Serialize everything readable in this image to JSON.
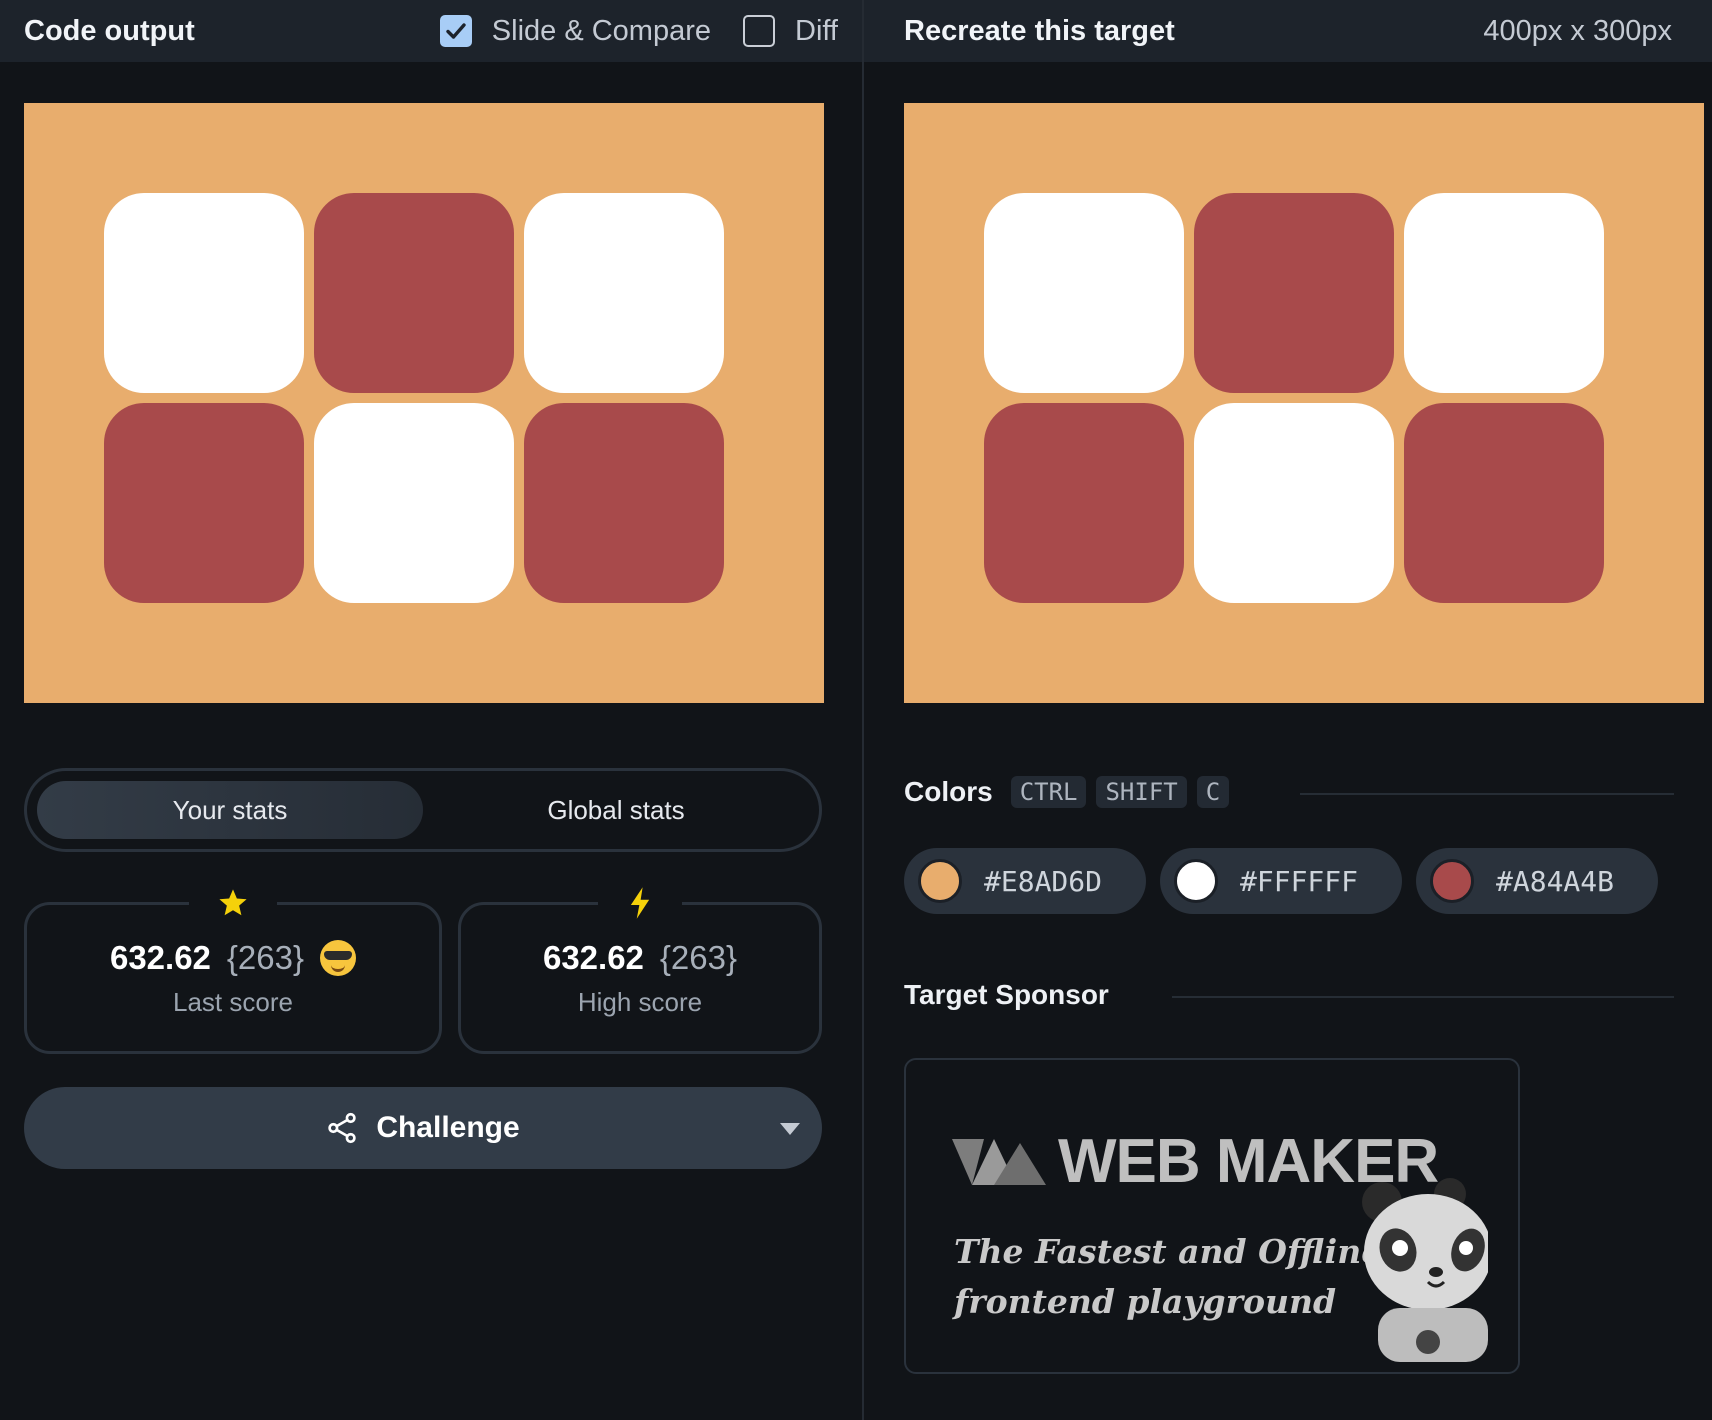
{
  "left_header": {
    "title": "Code output",
    "slide_compare_label": "Slide & Compare",
    "slide_compare_checked": true,
    "diff_label": "Diff",
    "diff_checked": false
  },
  "right_header": {
    "title": "Recreate this target",
    "dimensions": "400px x 300px"
  },
  "canvas": {
    "background": "#E8AD6D",
    "grid": [
      [
        "#FFFFFF",
        "#A84A4B",
        "#FFFFFF"
      ],
      [
        "#A84A4B",
        "#FFFFFF",
        "#A84A4B"
      ]
    ]
  },
  "stats_tabs": {
    "your_stats": "Your stats",
    "global_stats": "Global stats",
    "active": "your_stats"
  },
  "last_score": {
    "score": "632.62",
    "count": "{263}",
    "label": "Last score",
    "badge_icon": "star-icon",
    "emoji_icon": "sunglasses-emoji-icon"
  },
  "high_score": {
    "score": "632.62",
    "count": "{263}",
    "label": "High score",
    "badge_icon": "lightning-icon"
  },
  "challenge": {
    "label": "Challenge",
    "icon": "share-icon"
  },
  "colors_section": {
    "title": "Colors",
    "shortcut": [
      "CTRL",
      "SHIFT",
      "C"
    ],
    "swatches": [
      {
        "hex": "#E8AD6D",
        "color": "#E8AD6D"
      },
      {
        "hex": "#FFFFFF",
        "color": "#FFFFFF"
      },
      {
        "hex": "#A84A4B",
        "color": "#A84A4B"
      }
    ]
  },
  "sponsor": {
    "title": "Target Sponsor",
    "brand": "WEB MAKER",
    "tagline_line1": "The Fastest and Offline",
    "tagline_line2": "frontend playground"
  }
}
